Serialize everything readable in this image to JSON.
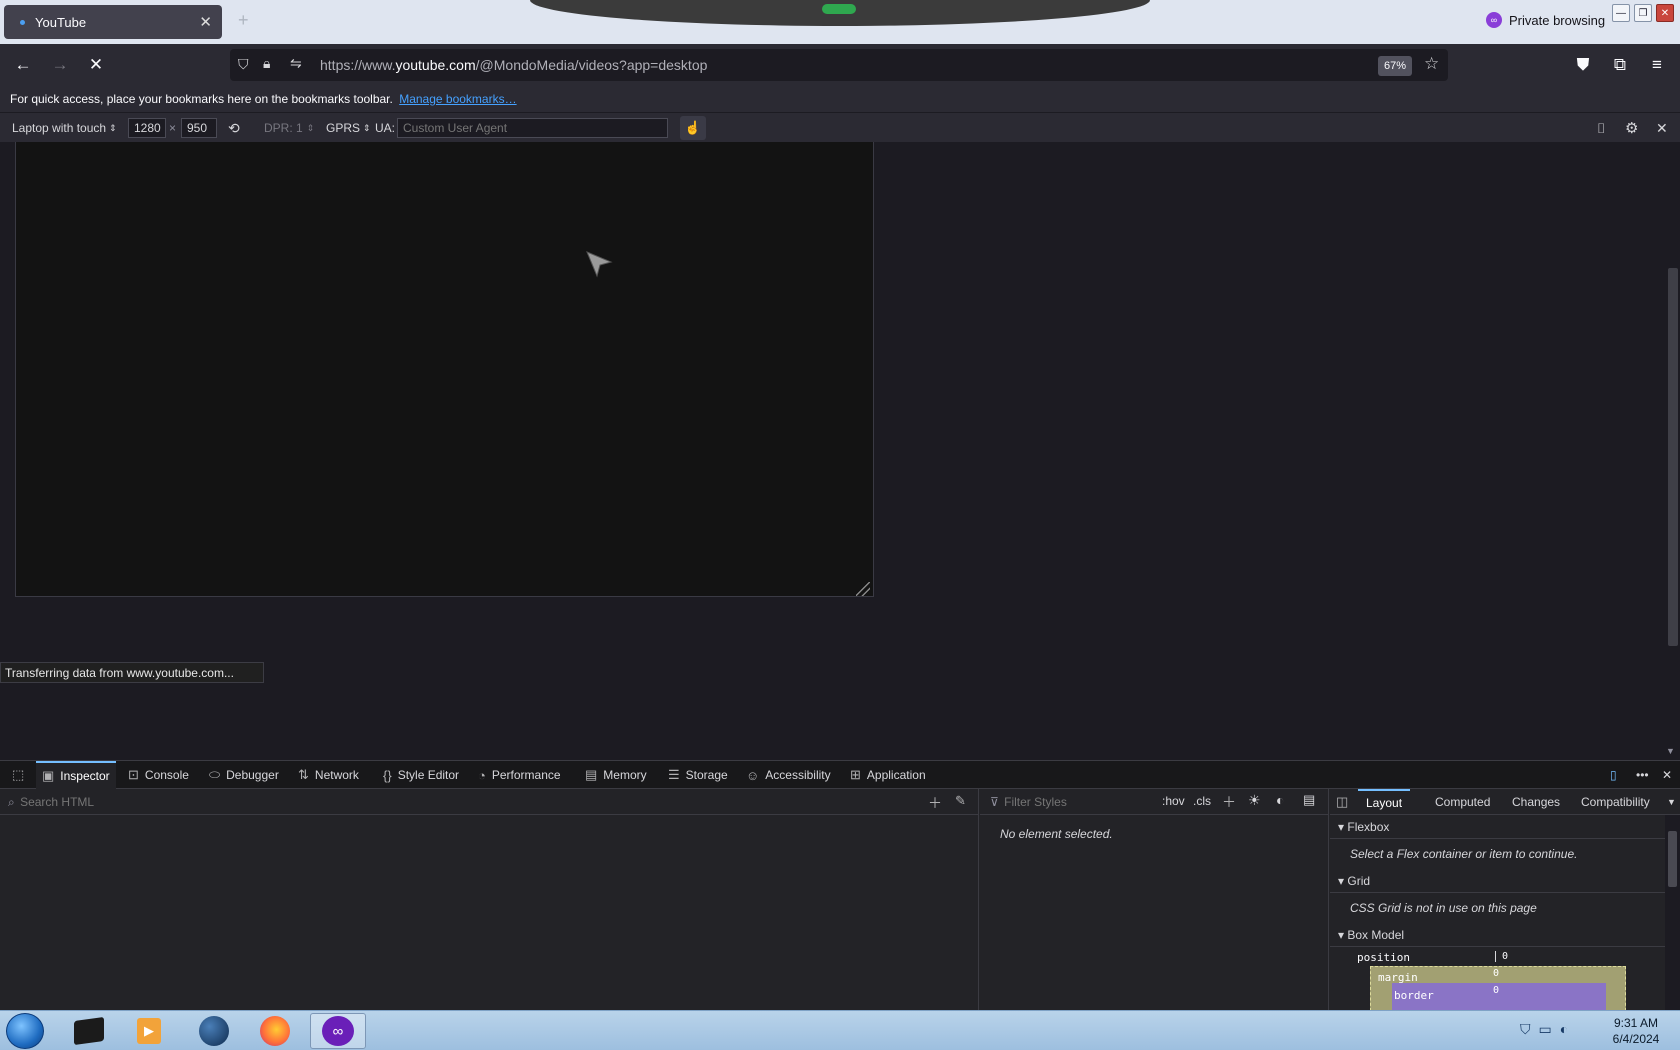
{
  "tab": {
    "title": "YouTube"
  },
  "window": {
    "private_label": "Private browsing"
  },
  "nav": {
    "url_prefix": "https://www.",
    "url_host": "youtube.com",
    "url_path": "/@MondoMedia/videos?app=desktop",
    "zoom": "67%"
  },
  "bookmarks": {
    "message": "For quick access, place your bookmarks here on the bookmarks toolbar.",
    "manage_link": "Manage bookmarks…"
  },
  "rdm": {
    "device": "Laptop with touch",
    "width": "1280",
    "times": "×",
    "height": "950",
    "dpr": "DPR: 1",
    "throttle": "GPRS",
    "ua_label": "UA:",
    "ua_placeholder": "Custom User Agent"
  },
  "status": {
    "text": "Transferring data from www.youtube.com..."
  },
  "devtools": {
    "tabs": [
      {
        "label": "Inspector",
        "icon": "inspector-icon"
      },
      {
        "label": "Console",
        "icon": "console-icon"
      },
      {
        "label": "Debugger",
        "icon": "debugger-icon"
      },
      {
        "label": "Network",
        "icon": "network-icon"
      },
      {
        "label": "Style Editor",
        "icon": "style-editor-icon"
      },
      {
        "label": "Performance",
        "icon": "performance-icon"
      },
      {
        "label": "Memory",
        "icon": "memory-icon"
      },
      {
        "label": "Storage",
        "icon": "storage-icon"
      },
      {
        "label": "Accessibility",
        "icon": "accessibility-icon"
      },
      {
        "label": "Application",
        "icon": "application-icon"
      }
    ],
    "search_placeholder": "Search HTML",
    "filter_placeholder": "Filter Styles",
    "hov": ":hov",
    "cls": ".cls",
    "no_element": "No element selected.",
    "side_tabs": [
      "Layout",
      "Computed",
      "Changes",
      "Compatibility"
    ],
    "flexbox": {
      "title": "Flexbox",
      "message": "Select a Flex container or item to continue."
    },
    "grid": {
      "title": "Grid",
      "message": "CSS Grid is not in use on this page"
    },
    "boxmodel": {
      "title": "Box Model",
      "position_label": "position",
      "position_value": "0",
      "margin_label": "margin",
      "margin_value": "0",
      "border_label": "border",
      "border_value": "0"
    }
  },
  "taskbar": {
    "time": "9:31 AM",
    "date": "6/4/2024"
  },
  "colors": {
    "accent": "#75bfff",
    "link": "#45a1ff",
    "private": "#8a3ed8"
  }
}
